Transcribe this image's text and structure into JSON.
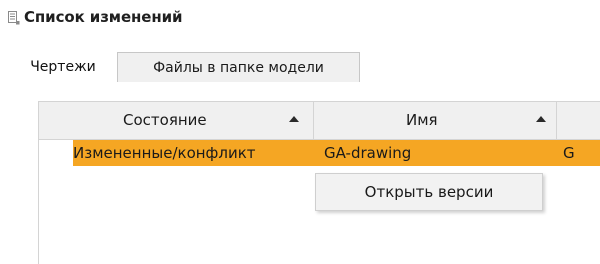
{
  "panel": {
    "title": "Список изменений",
    "title_icon": "list-document-icon"
  },
  "tabs": [
    {
      "label": "Чертежи",
      "active": true
    },
    {
      "label": "Файлы в папке модели",
      "active": false
    }
  ],
  "grid": {
    "columns": [
      {
        "label": "Состояние",
        "sort": "ascending"
      },
      {
        "label": "Имя",
        "sort": "ascending"
      },
      {
        "label": ""
      }
    ],
    "rows": [
      {
        "state": "Измененные/конфликт",
        "name": "GA-drawing",
        "extra": "G",
        "selected": true
      }
    ]
  },
  "context_menu": {
    "items": [
      {
        "label": "Открыть версии"
      }
    ]
  },
  "colors": {
    "selection": "#f5a623",
    "header_bg": "#f0f0f0",
    "menu_bg": "#f2f2f2"
  }
}
